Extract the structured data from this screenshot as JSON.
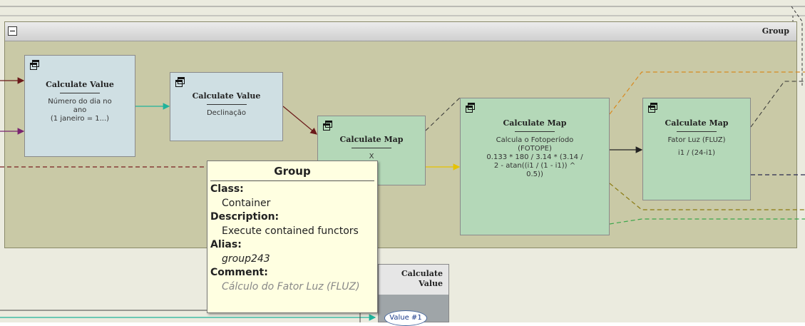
{
  "group": {
    "title": "Group"
  },
  "nodes": {
    "cv_day": {
      "title": "Calculate Value",
      "line1": "Número do dia no",
      "line2": "ano",
      "line3": "(1 janeiro = 1...)"
    },
    "cv_decl": {
      "title": "Calculate Value",
      "line1": "Declinação"
    },
    "cm_x": {
      "title": "Calculate Map",
      "line1": "X"
    },
    "cm_foto": {
      "title": "Calculate Map",
      "line1": "Calcula o Fotoperíodo",
      "line2": "(FOTOPE)",
      "line3": "0.133 * 180 / 3.14 * (3.14 /",
      "line4": "2 - atan((i1 / (1 - i1)) ^",
      "line5": "0.5))"
    },
    "cm_fluz": {
      "title": "Calculate Map",
      "line1": "Fator Luz (FLUZ)",
      "line2": "i1 / (24-i1)"
    },
    "cv_value": {
      "title_line1": "Calculate",
      "title_line2": "Value",
      "port": "Value #1"
    }
  },
  "tooltip": {
    "title": "Group",
    "class_label": "Class:",
    "class_value": "Container",
    "description_label": "Description:",
    "description_value": "Execute contained functors",
    "alias_label": "Alias:",
    "alias_value": "group243",
    "comment_label": "Comment:",
    "comment_value": "Cálculo do Fator Luz (FLUZ)"
  },
  "colors": {
    "group_bg": "#c9c9a6",
    "value_node": "#cfdfe3",
    "map_node": "#b4d8b8",
    "tooltip_bg": "#ffffe1",
    "wire_teal": "#1fb39b",
    "wire_maroon": "#6b1a1a",
    "wire_purple": "#7a2470",
    "wire_yellow": "#e6c200",
    "wire_orange": "#d88a20",
    "wire_green": "#3aa64a",
    "wire_olive": "#8a7a10"
  }
}
